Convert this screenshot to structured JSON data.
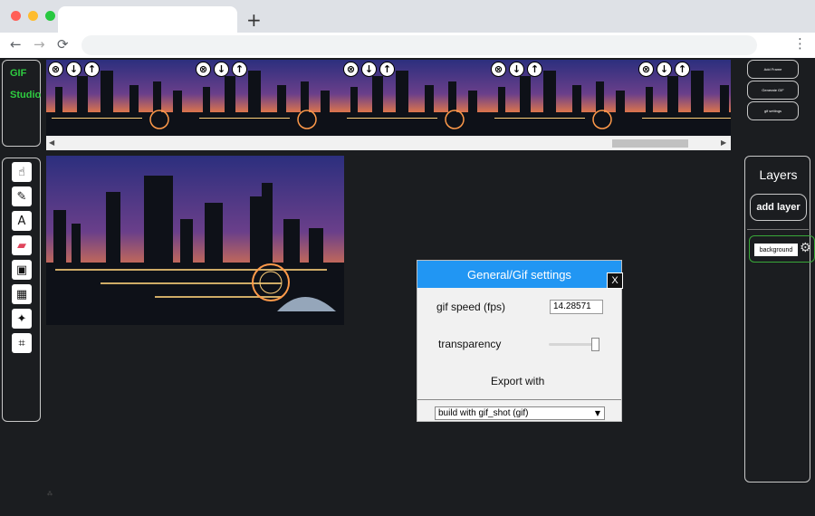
{
  "browser": {
    "new_tab_glyph": "+",
    "back_glyph": "←",
    "forward_glyph": "→",
    "reload_glyph": "⟳",
    "menu_glyph": "⋮",
    "traffic_lights": [
      "#ff5f57",
      "#febc2e",
      "#28c840"
    ]
  },
  "app": {
    "logo_line1": "GIF",
    "logo_line2": "Studio",
    "accent_color": "#2ecc40",
    "frame_controls": {
      "delete": "⊗",
      "down": "↓",
      "up": "↑"
    },
    "frame_count_visible": 5,
    "scroll": {
      "left": "◀",
      "right": "▶"
    },
    "right_buttons": [
      "Add Frame",
      "Generate GIF",
      "gif settings"
    ],
    "tools": [
      {
        "icon": "hand-pointer-icon",
        "glyph": "☝"
      },
      {
        "icon": "pencil-icon",
        "glyph": "✎"
      },
      {
        "icon": "text-tool-icon",
        "glyph": "A"
      },
      {
        "icon": "eraser-icon",
        "glyph": "▰"
      },
      {
        "icon": "image-gallery-icon",
        "glyph": "▣"
      },
      {
        "icon": "add-image-icon",
        "glyph": "▦"
      },
      {
        "icon": "magic-wand-icon",
        "glyph": "✦"
      },
      {
        "icon": "crop-icon",
        "glyph": "⌗"
      }
    ],
    "layers": {
      "title": "Layers",
      "add_label": "add layer",
      "items": [
        {
          "name": "background",
          "gear": "⚙"
        }
      ]
    },
    "footer_mark": "⁂"
  },
  "dialog": {
    "title": "General/Gif settings",
    "close_label": "X",
    "speed_label": "gif speed (fps)",
    "speed_value": "14.28571",
    "transparency_label": "transparency",
    "transparency_level": 1.0,
    "export_label": "Export with",
    "builder_value": "build with gif_shot (gif)",
    "builder_arrow": "▼",
    "header_color": "#2196f3"
  }
}
